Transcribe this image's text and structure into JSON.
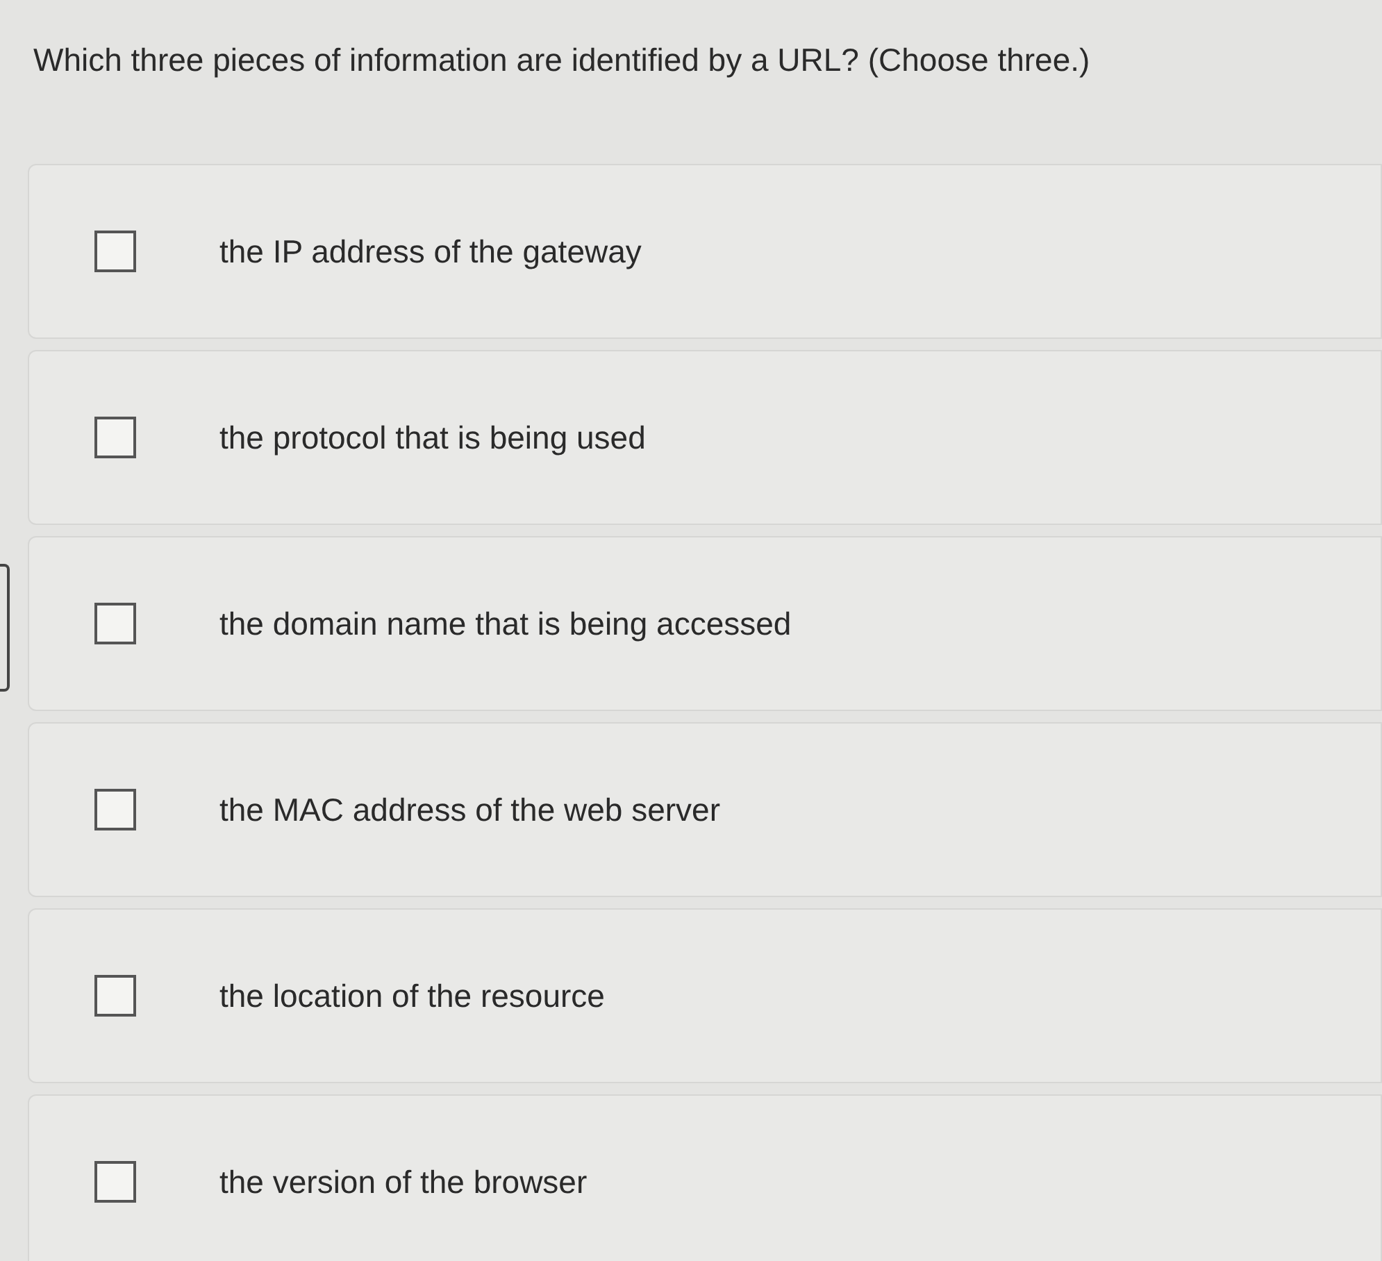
{
  "question": "Which three pieces of information are identified by a URL? (Choose three.)",
  "options": [
    {
      "label": "the IP address of the gateway",
      "checked": false,
      "focused": false
    },
    {
      "label": "the protocol that is being used",
      "checked": false,
      "focused": false
    },
    {
      "label": "the domain name that is being accessed",
      "checked": false,
      "focused": true
    },
    {
      "label": "the MAC address of the web server",
      "checked": false,
      "focused": false
    },
    {
      "label": "the location of the resource",
      "checked": false,
      "focused": false
    },
    {
      "label": "the version of the browser",
      "checked": false,
      "focused": false
    }
  ]
}
